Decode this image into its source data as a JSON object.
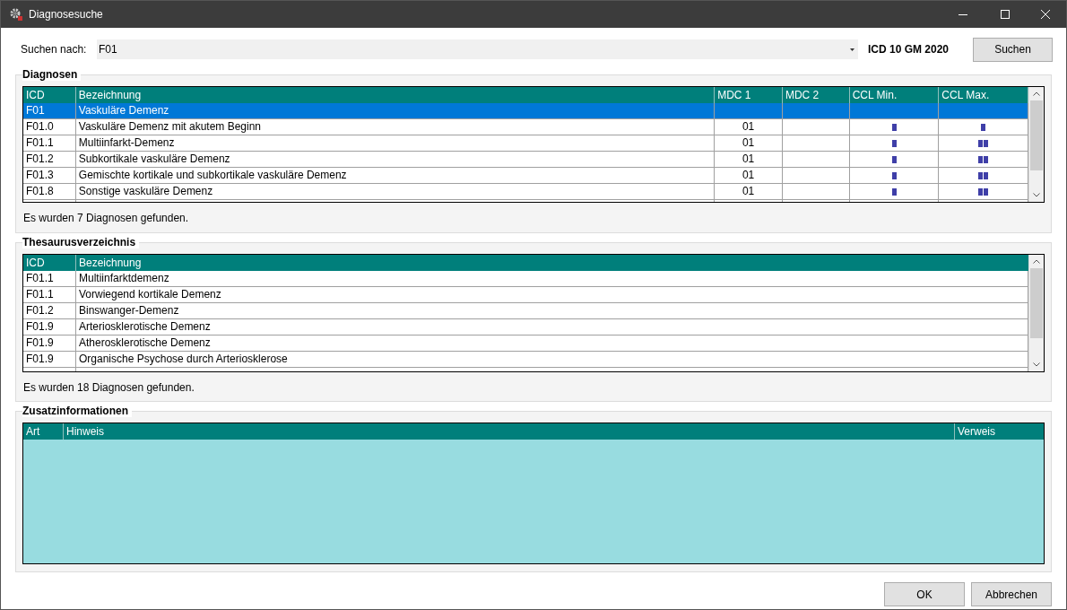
{
  "window": {
    "title": "Diagnosesuche"
  },
  "search": {
    "label": "Suchen nach:",
    "value": "F01",
    "catalog": "ICD 10 GM 2020",
    "button": "Suchen"
  },
  "diagnosen": {
    "title": "Diagnosen",
    "columns": [
      "ICD",
      "Bezeichnung",
      "MDC 1",
      "MDC 2",
      "CCL Min.",
      "CCL Max."
    ],
    "rows": [
      {
        "icd": "F01",
        "name": "Vaskuläre Demenz",
        "mdc1": "",
        "selected": true,
        "ccl_min": null,
        "ccl_max": null
      },
      {
        "icd": "F01.0",
        "name": "Vaskuläre Demenz mit akutem Beginn",
        "mdc1": "01",
        "selected": false,
        "ccl_min": {
          "kind": "single"
        },
        "ccl_max": {
          "kind": "single"
        }
      },
      {
        "icd": "F01.1",
        "name": "Multiinfarkt-Demenz",
        "mdc1": "01",
        "selected": false,
        "ccl_min": {
          "kind": "single"
        },
        "ccl_max": {
          "kind": "double"
        }
      },
      {
        "icd": "F01.2",
        "name": "Subkortikale vaskuläre Demenz",
        "mdc1": "01",
        "selected": false,
        "ccl_min": {
          "kind": "single"
        },
        "ccl_max": {
          "kind": "double"
        }
      },
      {
        "icd": "F01.3",
        "name": "Gemischte kortikale und subkortikale vaskuläre Demenz",
        "mdc1": "01",
        "selected": false,
        "ccl_min": {
          "kind": "single"
        },
        "ccl_max": {
          "kind": "double"
        }
      },
      {
        "icd": "F01.8",
        "name": "Sonstige vaskuläre Demenz",
        "mdc1": "01",
        "selected": false,
        "ccl_min": {
          "kind": "single"
        },
        "ccl_max": {
          "kind": "double"
        }
      }
    ],
    "status": "Es wurden 7 Diagnosen gefunden."
  },
  "thesaurus": {
    "title": "Thesaurusverzeichnis",
    "columns": [
      "ICD",
      "Bezeichnung"
    ],
    "rows": [
      {
        "icd": "F01.1",
        "name": "Multiinfarktdemenz"
      },
      {
        "icd": "F01.1",
        "name": "Vorwiegend kortikale Demenz"
      },
      {
        "icd": "F01.2",
        "name": "Binswanger-Demenz"
      },
      {
        "icd": "F01.9",
        "name": "Arteriosklerotische Demenz"
      },
      {
        "icd": "F01.9",
        "name": "Atherosklerotische Demenz"
      },
      {
        "icd": "F01.9",
        "name": "Organische Psychose durch Arteriosklerose"
      }
    ],
    "status": "Es wurden 18 Diagnosen gefunden."
  },
  "zusatz": {
    "title": "Zusatzinformationen",
    "columns": [
      "Art",
      "Hinweis",
      "Verweis"
    ]
  },
  "buttons": [
    "OK",
    "Abbrechen"
  ]
}
